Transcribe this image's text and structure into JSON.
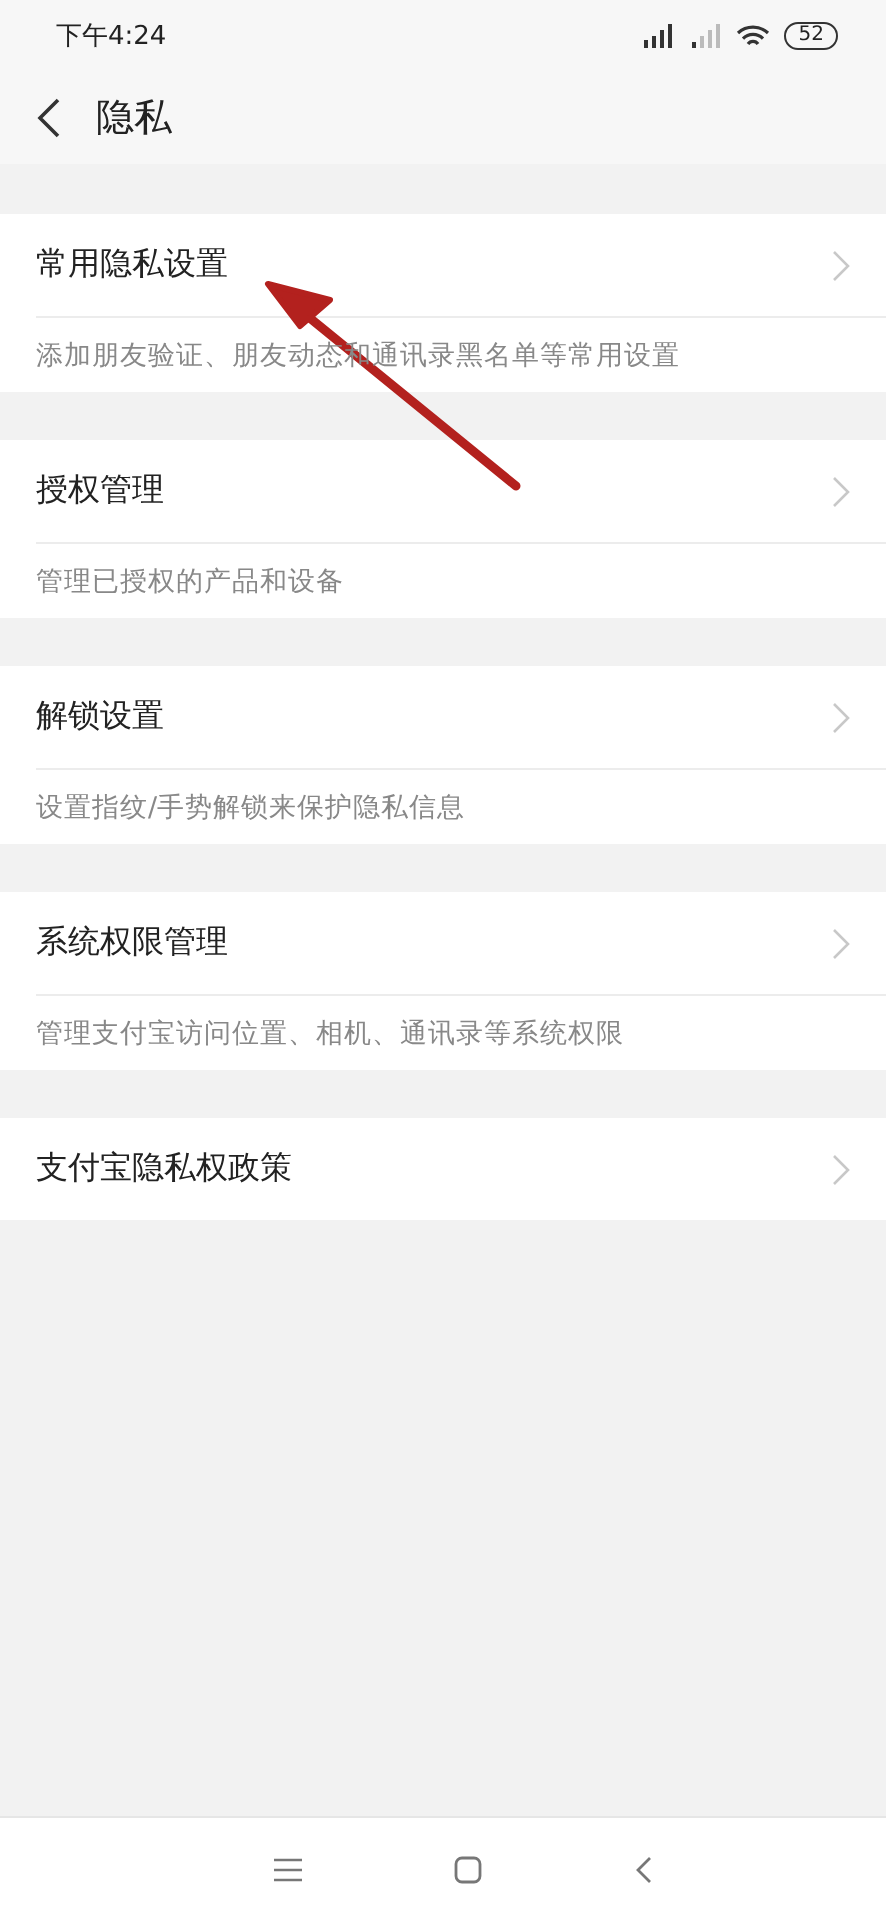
{
  "status_bar": {
    "time": "下午4:24",
    "battery": "52"
  },
  "header": {
    "title": "隐私"
  },
  "sections": [
    {
      "title": "常用隐私设置",
      "description": "添加朋友验证、朋友动态和通讯录黑名单等常用设置"
    },
    {
      "title": "授权管理",
      "description": "管理已授权的产品和设备"
    },
    {
      "title": "解锁设置",
      "description": "设置指纹/手势解锁来保护隐私信息"
    },
    {
      "title": "系统权限管理",
      "description": "管理支付宝访问位置、相机、通讯录等系统权限"
    },
    {
      "title": "支付宝隐私权政策"
    }
  ]
}
